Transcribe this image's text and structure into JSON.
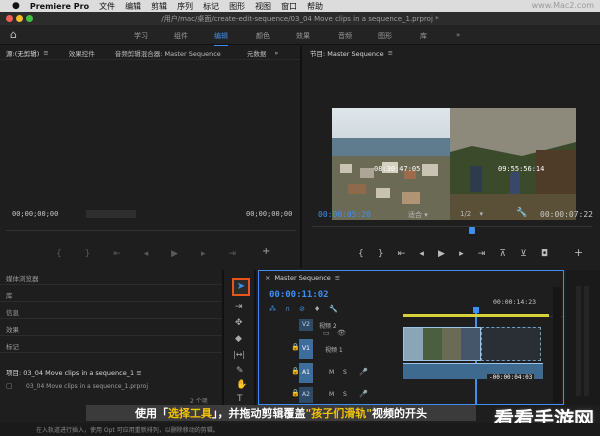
{
  "menubar": {
    "apple": "",
    "app_name": "Premiere Pro",
    "items": [
      "文件",
      "编辑",
      "剪辑",
      "序列",
      "标记",
      "图形",
      "视图",
      "窗口",
      "帮助"
    ],
    "watermark_url": "www.Mac2.com"
  },
  "titlebar": {
    "title": "/用户/mac/桌面/create-edit-sequence/03_04 Move clips in a sequence_1.prproj *"
  },
  "workspaces": {
    "items": [
      "学习",
      "组件",
      "编辑",
      "颜色",
      "效果",
      "音频",
      "图形",
      "库"
    ],
    "active_index": 2,
    "more": "»"
  },
  "source_panel": {
    "tab": "源:(无剪辑)",
    "tab2": "效果控件",
    "tab3": "音频剪辑混合器: Master Sequence",
    "tab4": "元数据",
    "more": "»",
    "timecode_left": "00;00;00;00",
    "timecode_right": "00;00;00;00"
  },
  "program_panel": {
    "tab": "节目: Master Sequence",
    "frame_left_tc": "08:30:47:05",
    "frame_right_tc": "09:55:56:14",
    "timecode_left": "00:00:05:20",
    "fit": "适合",
    "resolution": "1/2",
    "timecode_right": "00:00:07:22"
  },
  "project_panel": {
    "tabs": [
      "媒体浏览器",
      "库",
      "信息",
      "效果",
      "标记"
    ],
    "project_title": "项目: 03_04 Move clips in a sequence_1",
    "project_file": "03_04 Move clips in a sequence_1.prproj",
    "items_count": "2 个项"
  },
  "timeline": {
    "tab": "Master Sequence",
    "timecode": "00:00:11:02",
    "ruler_label": "00:00:14:23",
    "tracks": [
      {
        "id": "V2",
        "name": "视频 2"
      },
      {
        "id": "V1",
        "name": "视频 1"
      },
      {
        "id": "A1",
        "name": ""
      },
      {
        "id": "A2",
        "name": ""
      }
    ],
    "source_v": "V1",
    "source_a": "A1",
    "mute": "M",
    "solo": "S",
    "overlay_tc": "-00:00:04:03"
  },
  "subtitle": {
    "part1": "使用「",
    "part2": "选择工具",
    "part3": "」，并拖动剪辑覆盖",
    "part4": "\"孩子们滑轨\"",
    "part5": "视频的开头"
  },
  "watermark": "看看手游网",
  "statusbar": {
    "text": "在入轨道进行插入，使用 Opt 可应用重新排列，以删除移动的剪辑。"
  },
  "colors": {
    "accent": "#3e8ff0",
    "highlight": "#f5c400",
    "clip": "#6ea0c8"
  }
}
